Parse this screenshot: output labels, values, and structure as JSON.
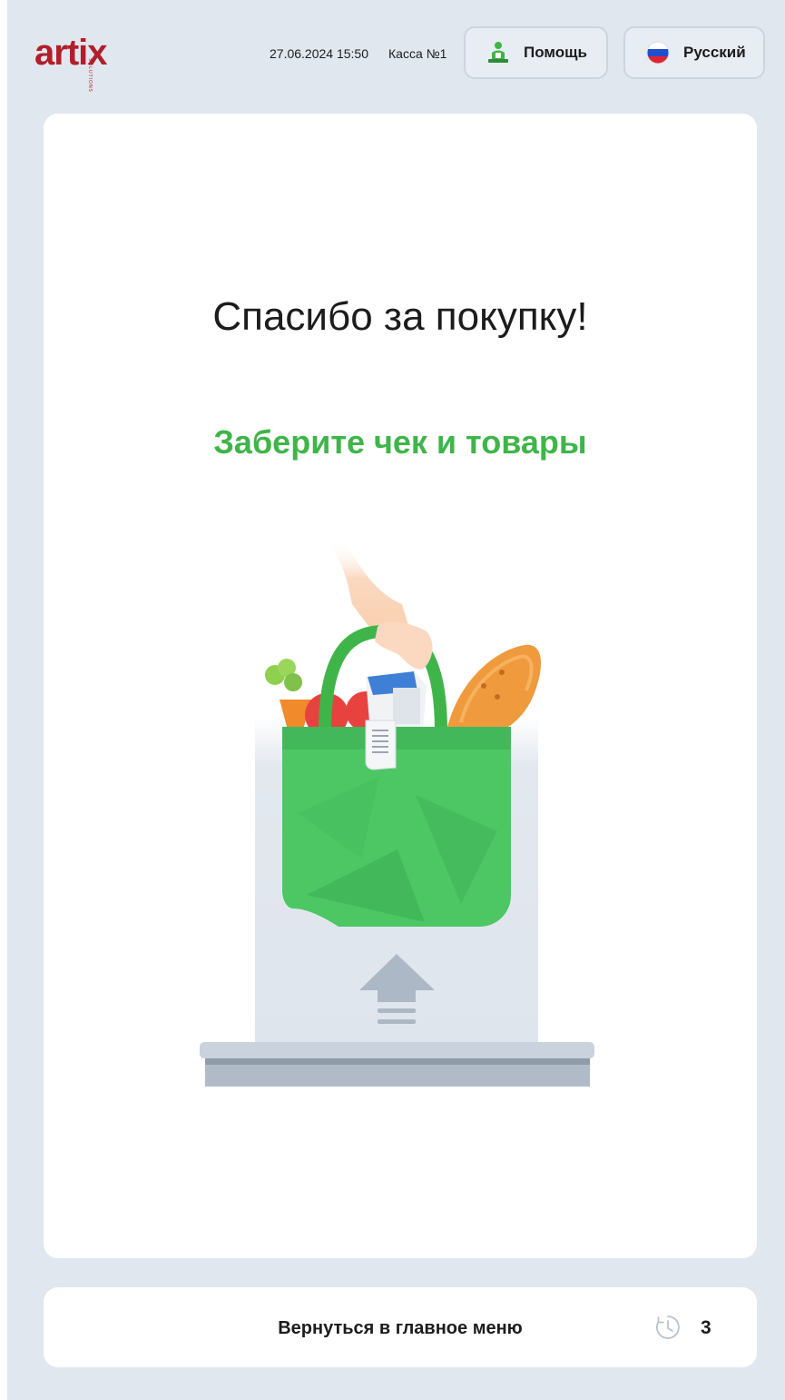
{
  "header": {
    "logo_text": "artix",
    "logo_sub": "SOLUTIONS",
    "datetime": "27.06.2024 15:50",
    "register": "Касса №1",
    "help_label": "Помощь",
    "language_label": "Русский"
  },
  "main": {
    "title": "Спасибо за покупку!",
    "subtitle": "Заберите чек и товары"
  },
  "footer": {
    "back_label": "Вернуться в главное меню",
    "timer_value": "3",
    "timer_icon": "clock-icon"
  },
  "colors": {
    "brand": "#b11f2a",
    "accent_green": "#3fb549",
    "background": "#e1e7ef"
  }
}
